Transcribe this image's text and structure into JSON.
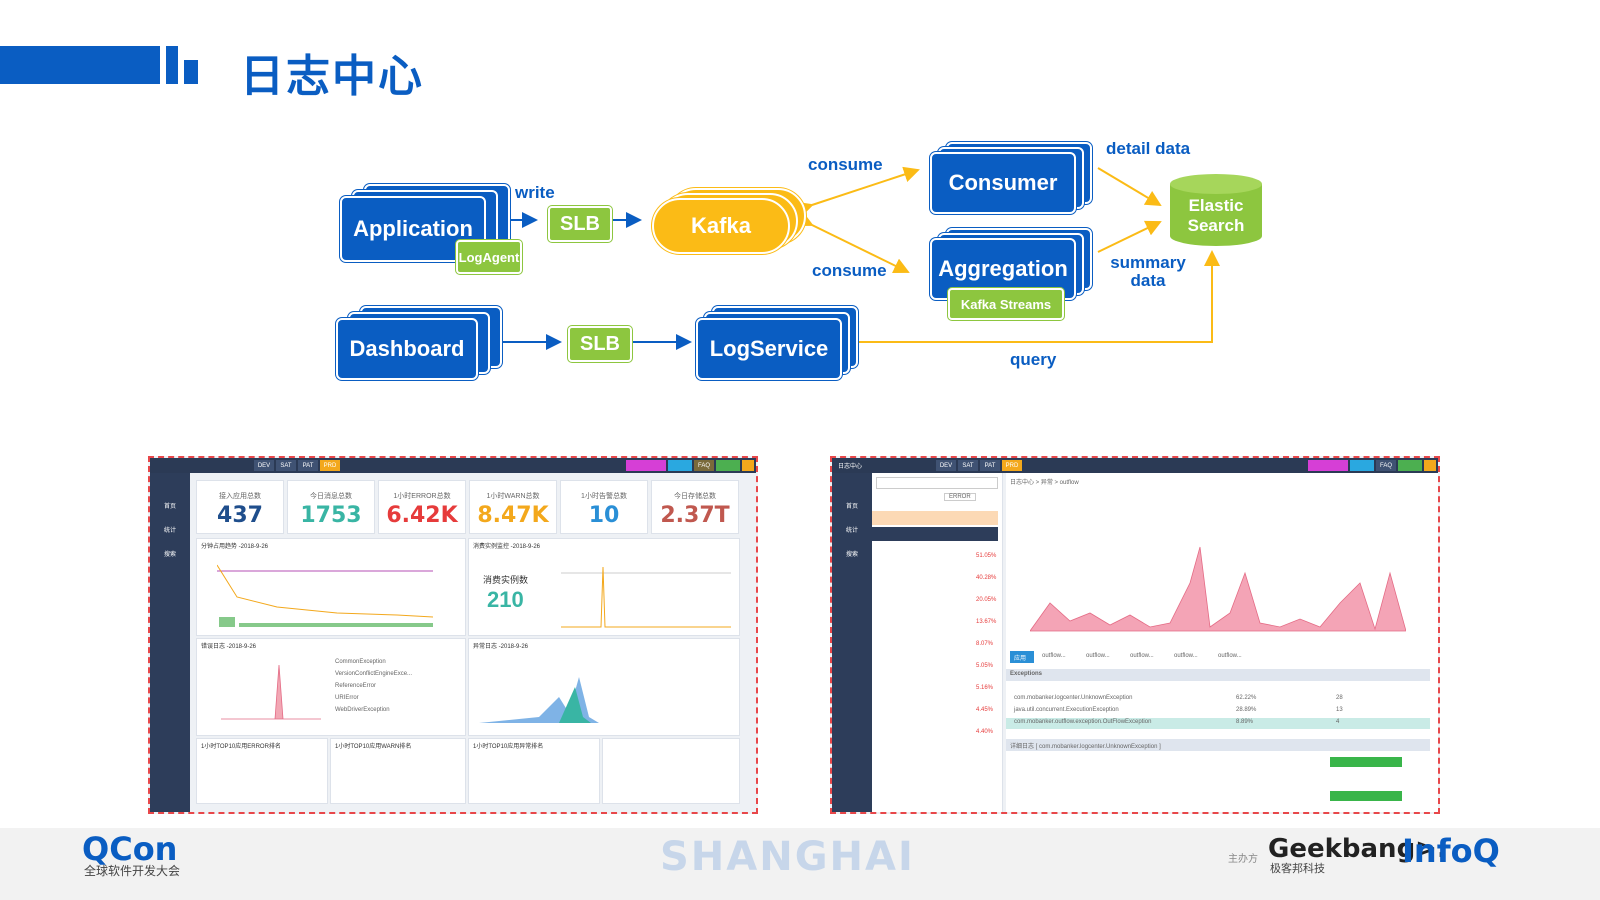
{
  "header": {
    "title": "日志中心"
  },
  "diagram": {
    "application": "Application",
    "logagent": "LogAgent",
    "slb_top": "SLB",
    "kafka": "Kafka",
    "consumer": "Consumer",
    "aggregation": "Aggregation",
    "kafka_streams": "Kafka Streams",
    "elastic": "Elastic Search",
    "dashboard": "Dashboard",
    "slb_bottom": "SLB",
    "logservice": "LogService",
    "write": "write",
    "consume_top": "consume",
    "consume_bottom": "consume",
    "detail_data": "detail data",
    "summary_data": "summary data",
    "query": "query"
  },
  "left_shot": {
    "nav": [
      "首页",
      "统计",
      "搜索"
    ],
    "stats": [
      {
        "label": "接入应用总数",
        "value": "437",
        "color": "#1f4e8c"
      },
      {
        "label": "今日消息总数",
        "value": "1753",
        "color": "#39b5a4"
      },
      {
        "label": "1小时ERROR总数",
        "value": "6.42K",
        "color": "#e63b3b"
      },
      {
        "label": "1小时WARN总数",
        "value": "8.47K",
        "color": "#f3a81c"
      },
      {
        "label": "1小时告警总数",
        "value": "10",
        "color": "#2a8fd6"
      },
      {
        "label": "今日存储总数",
        "value": "2.37T",
        "color": "#c0584f"
      }
    ],
    "panel_titles": [
      "分钟占用趋势 -2018-9-26",
      "消费实例监控 -2018-9-26",
      "错误日志 -2018-9-26",
      "异常日志 -2018-9-26"
    ],
    "consumer_label": "消费实例数",
    "consumer_value": "210",
    "bottom_titles": [
      "1小时TOP10应用ERROR排名",
      "1小时TOP10应用WARN排名",
      "1小时TOP10应用异常排名"
    ],
    "exceptions": [
      "CommonException",
      "VersionConflictEngineExce...",
      "ReferenceError",
      "URIError",
      "WebDriverException"
    ]
  },
  "right_shot": {
    "title": "日志中心",
    "nav": [
      "首页",
      "统计",
      "搜索"
    ],
    "level": "ERROR",
    "breadcrumb": "日志中心 > 异常 > outflow",
    "tabs": [
      "应用",
      "outflow...",
      "outflow...",
      "outflow...",
      "outflow...",
      "outflow...",
      "outflow..."
    ],
    "section": "Exceptions",
    "rows": [
      {
        "name": "com.mobanker.logcenter.UnknownException",
        "pct": "62.22%",
        "count": "28"
      },
      {
        "name": "java.util.concurrent.ExecutionException",
        "pct": "28.89%",
        "count": "13"
      },
      {
        "name": "com.mobanker.outflow.exception.OutFlowException",
        "pct": "8.89%",
        "count": "4"
      }
    ],
    "detail_title": "详细日志 [ com.mobanker.logcenter.UnknownException ]",
    "percentages": [
      "51.05%",
      "40.28%",
      "20.05%",
      "13.67%",
      "8.07%",
      "5.05%",
      "5.16%",
      "4.45%",
      "4.40%"
    ]
  },
  "footer": {
    "qcon": "QCon",
    "qcon_sub": "全球软件开发大会",
    "shanghai": "SHANGHAI",
    "host": "主办方",
    "geek": "Geekbang>.",
    "geek_sub": "极客邦科技",
    "infoq": "InfoQ"
  }
}
